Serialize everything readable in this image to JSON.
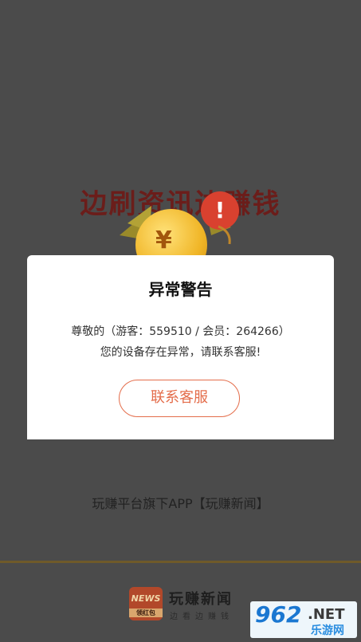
{
  "splash": {
    "banner_title": "边刷资讯边赚钱",
    "coin_symbol": "¥",
    "alert_symbol": "!",
    "tagline": "玩赚平台旗下APP【玩赚新闻】"
  },
  "footer": {
    "logo_top": "NEWS",
    "logo_bottom": "领红包",
    "brand": "玩赚新闻",
    "slogan": "边看边赚钱"
  },
  "watermark": {
    "number": "962",
    "net": ".NET",
    "site": "乐游网"
  },
  "dialog": {
    "title": "异常警告",
    "line1": "尊敬的（游客：559510 / 会员：264266）",
    "line2": "您的设备存在异常，请联系客服!",
    "button_label": "联系客服"
  },
  "colors": {
    "accent": "#e46d4b",
    "overlay": "#4b4b4b",
    "banner": "#6b1d1a"
  }
}
